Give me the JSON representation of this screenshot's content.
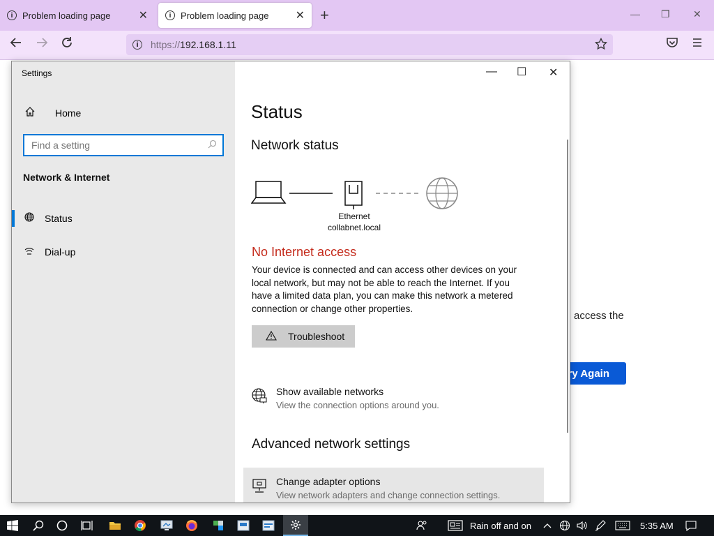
{
  "browser": {
    "tabs": [
      {
        "title": "Problem loading page",
        "active": false
      },
      {
        "title": "Problem loading page",
        "active": true
      }
    ],
    "url_protocol": "https://",
    "url_host": "192.168.1.11",
    "icons": {
      "tab_info": "info-icon",
      "new_tab": "plus-icon",
      "back": "back-arrow-icon",
      "forward": "forward-arrow-icon",
      "reload": "reload-icon",
      "bookmark": "star-icon",
      "pocket": "pocket-icon",
      "menu": "hamburger-menu-icon"
    }
  },
  "background_page": {
    "partial_text": "access the",
    "try_again": "ry Again"
  },
  "settings": {
    "window_title": "Settings",
    "home_label": "Home",
    "search_placeholder": "Find a setting",
    "section_heading": "Network & Internet",
    "nav_items": [
      {
        "label": "Status",
        "selected": true,
        "icon": "globe-icon"
      },
      {
        "label": "Dial-up",
        "selected": false,
        "icon": "dialup-icon"
      }
    ],
    "page_title": "Status",
    "network_status_heading": "Network status",
    "connection_name": "Ethernet",
    "connection_domain": "collabnet.local",
    "status_text": "No Internet access",
    "status_color": "#c42b1c",
    "description": "Your device is connected and can access other devices on your local network, but may not be able to reach the Internet. If you have a limited data plan, you can make this network a metered connection or change other properties.",
    "troubleshoot_label": "Troubleshoot",
    "show_networks_title": "Show available networks",
    "show_networks_sub": "View the connection options around you.",
    "advanced_heading": "Advanced network settings",
    "adapter_title": "Change adapter options",
    "adapter_sub": "View network adapters and change connection settings."
  },
  "taskbar": {
    "weather_text": "Rain off and on",
    "time": "5:35 AM",
    "accent": "#0078d7"
  }
}
